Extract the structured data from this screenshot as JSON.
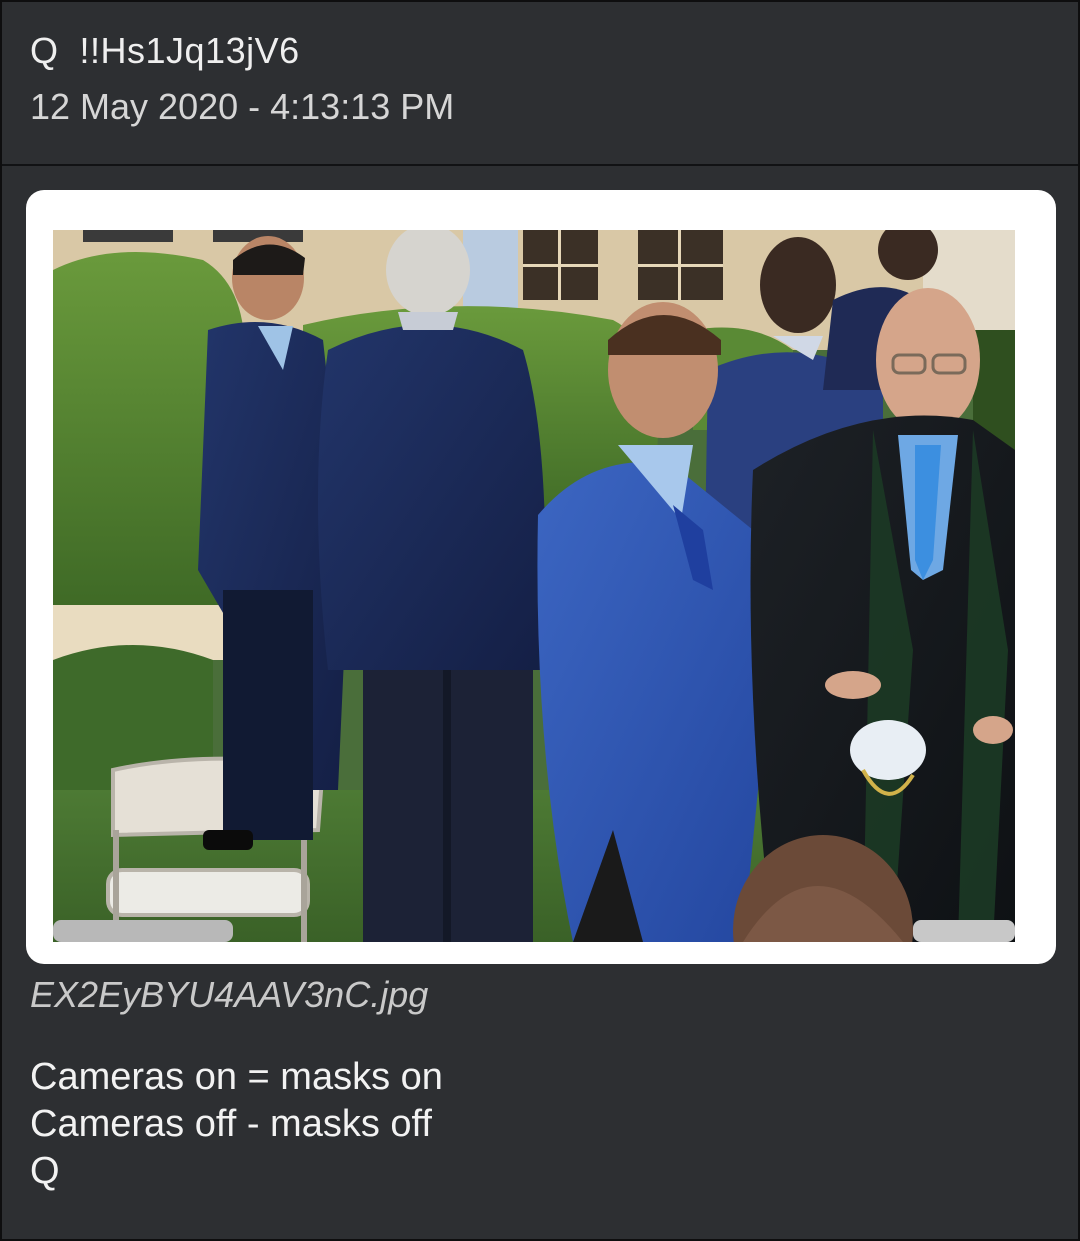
{
  "post": {
    "author": "Q  !!Hs1Jq13jV6",
    "timestamp": "12 May 2020 - 4:13:13 PM",
    "attachment": {
      "filename": "EX2EyBYU4AAV3nC.jpg"
    },
    "body_lines": [
      "Cameras on = masks on",
      "Cameras off - masks off",
      "Q"
    ]
  },
  "colors": {
    "background": "#2d2f32",
    "border": "#0e0e0f",
    "text": "#efefef",
    "muted_text": "#c9c9c9"
  }
}
